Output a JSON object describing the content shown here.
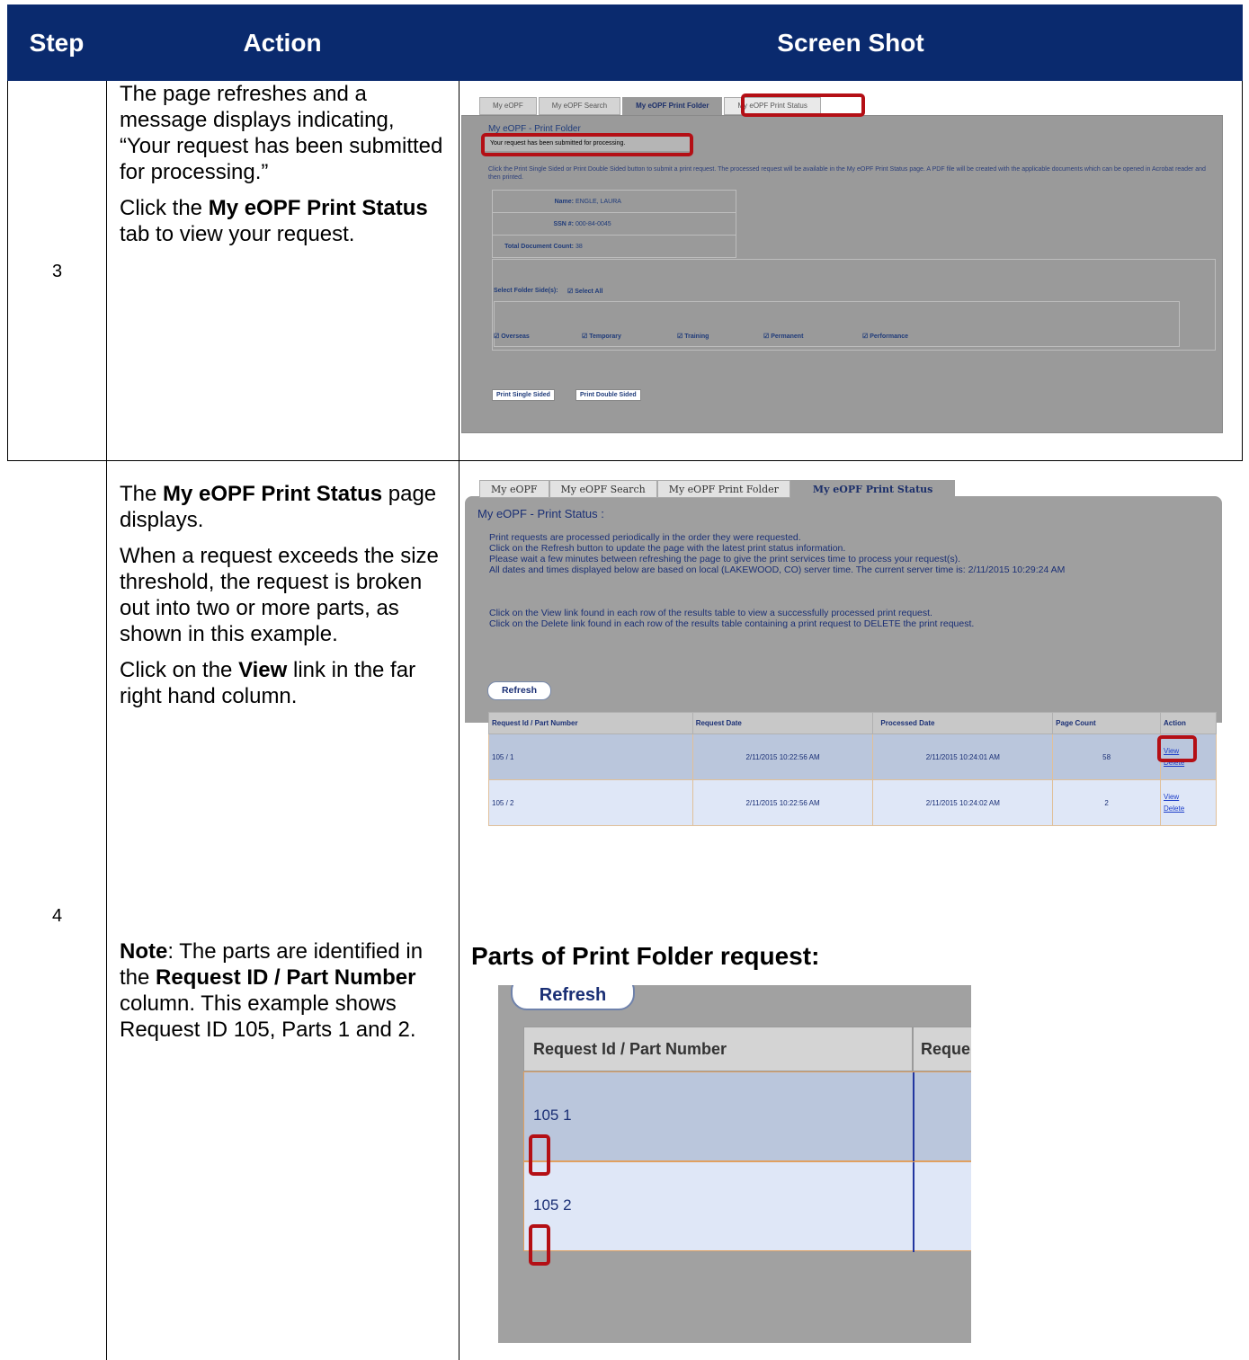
{
  "header": {
    "step": "Step",
    "action": "Action",
    "screenshot": "Screen Shot"
  },
  "rows": [
    {
      "step": "3",
      "action_p1": "The page refreshes and a message displays indicating, “Your request has been submitted for processing.”",
      "action_p2_pre": "Click the ",
      "action_p2_bold": "My eOPF Print Status",
      "action_p2_post": " tab to view your request."
    },
    {
      "step": "4",
      "action_p1_pre": "The ",
      "action_p1_bold": "My eOPF Print Status",
      "action_p1_post": " page displays.",
      "action_p2": "When a request exceeds the size threshold, the request is broken out into two or more parts, as shown in this example.",
      "action_p3_pre": "Click on the ",
      "action_p3_bold": "View",
      "action_p3_post": " link in the far right hand column.",
      "note_label": "Note",
      "note_a": ": The parts are identified in the ",
      "note_bold": "Request ID / Part Number",
      "note_b": " column. This example shows Request ID 105, Parts 1 and 2."
    }
  ],
  "screenshot1": {
    "tabs": [
      "My eOPF",
      "My eOPF Search",
      "My eOPF Print Folder",
      "My eOPF Print Status"
    ],
    "title": "My eOPF - Print Folder",
    "message": "Your request has been submitted for processing.",
    "instructions": "Click the Print Single Sided or Print Double Sided button to submit a print request. The processed request will be available in the My eOPF Print Status page. A PDF file will be created with the applicable documents which can be opened in Acrobat reader and then printed.",
    "name_label": "Name:",
    "name_value": "ENGLE, LAURA",
    "ssn_label": "SSN #:",
    "ssn_value": "000-84-0045",
    "count_label": "Total Document Count:",
    "count_value": "38",
    "select_label": "Select Folder Side(s):",
    "select_all": "Select All",
    "sides": [
      "Overseas",
      "Temporary",
      "Training",
      "Permanent",
      "Performance"
    ],
    "btn_single": "Print Single Sided",
    "btn_double": "Print Double Sided"
  },
  "screenshot2": {
    "tabs": [
      "My eOPF",
      "My eOPF Search",
      "My eOPF Print Folder",
      "My eOPF Print Status"
    ],
    "title": "My eOPF - Print Status :",
    "lines": [
      "Print requests are processed periodically in the order they were requested.",
      "Click on the Refresh button to update the page with the latest print status information.",
      "Please wait a few minutes between refreshing the page to give the print services time to process your request(s).",
      "All dates and times displayed below are based on local (LAKEWOOD, CO) server time. The current server time is: 2/11/2015 10:29:24 AM"
    ],
    "lines2": [
      "Click on the View link found in each row of the results table to view a successfully processed print request.",
      "Click on the Delete link found in each row of the results table containing a print request to DELETE the print request."
    ],
    "refresh": "Refresh",
    "columns": [
      "Request Id / Part Number",
      "Request Date",
      "Processed Date",
      "Page Count",
      "Action"
    ],
    "table": [
      {
        "id": "105 / 1",
        "req": "2/11/2015 10:22:56 AM",
        "proc": "2/11/2015 10:24:01 AM",
        "pages": "58"
      },
      {
        "id": "105 / 2",
        "req": "2/11/2015 10:22:56 AM",
        "proc": "2/11/2015 10:24:02 AM",
        "pages": "2"
      }
    ],
    "view": "View",
    "delete": "Delete"
  },
  "caption": "Parts of Print Folder request:",
  "screenshot3": {
    "refresh": "Refresh",
    "col1": "Request Id / Part Number",
    "col2": "Reque",
    "row1_id": "105",
    "row1_part": "1",
    "row2_id": "105",
    "row2_part": "2"
  }
}
